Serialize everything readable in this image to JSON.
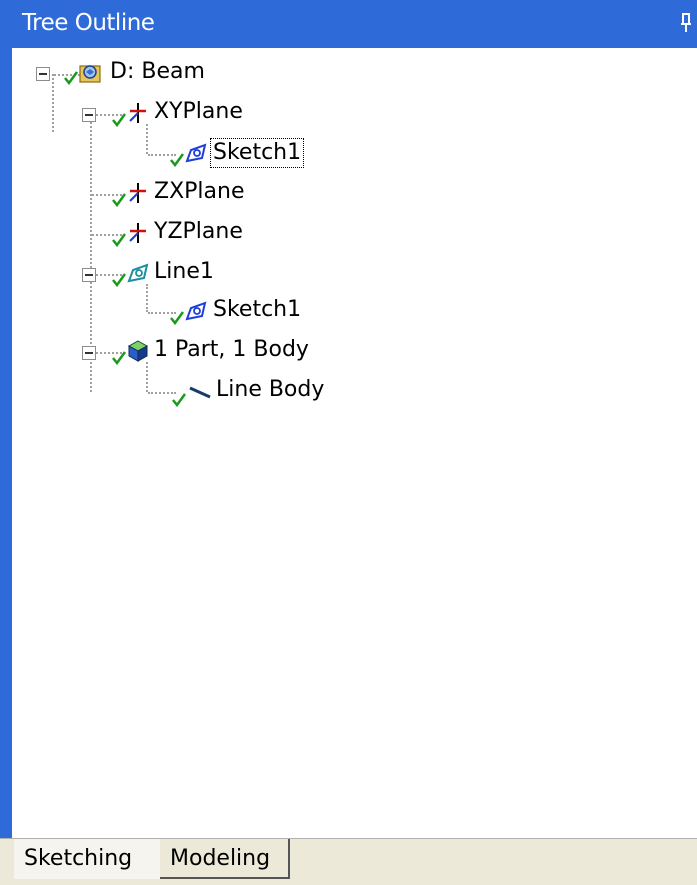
{
  "window": {
    "title": "Tree Outline",
    "pin_icon": "pin-icon"
  },
  "tree": {
    "nodes": [
      {
        "label": "D: Beam",
        "icon": "model-icon",
        "expanded": true
      },
      {
        "label": "XYPlane",
        "icon": "plane-axes-icon",
        "expanded": true
      },
      {
        "label": "Sketch1",
        "icon": "sketch-icon",
        "selected": true
      },
      {
        "label": "ZXPlane",
        "icon": "plane-axes-icon"
      },
      {
        "label": "YZPlane",
        "icon": "plane-axes-icon"
      },
      {
        "label": "Line1",
        "icon": "line-feature-icon",
        "expanded": true
      },
      {
        "label": "Sketch1",
        "icon": "sketch-icon"
      },
      {
        "label": "1 Part, 1 Body",
        "icon": "part-cube-icon",
        "expanded": true
      },
      {
        "label": "Line Body",
        "icon": "line-body-icon"
      }
    ]
  },
  "tabs": [
    {
      "label": "Sketching",
      "active": true
    },
    {
      "label": "Modeling",
      "active": false
    }
  ],
  "colors": {
    "titlebar": "#2e6bd9",
    "check": "#1a9a1a",
    "sketch_icon": "#1f3fd8"
  }
}
